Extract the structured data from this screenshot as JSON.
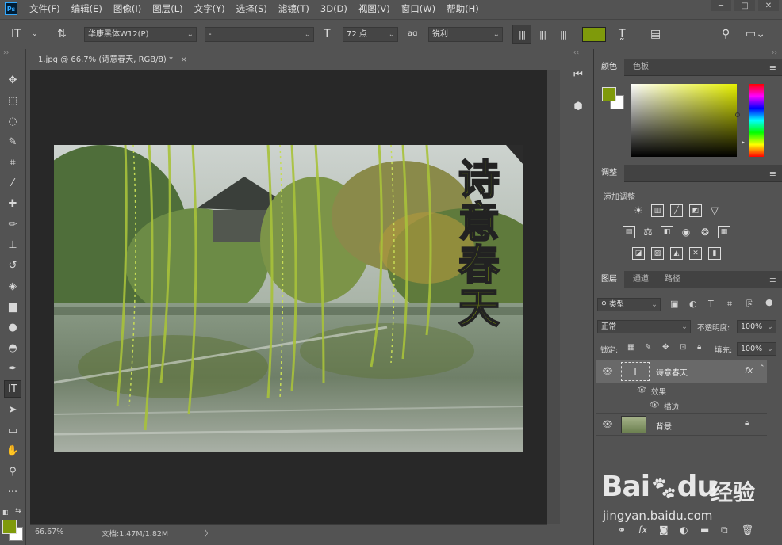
{
  "menu": {
    "logo": "Ps",
    "items": [
      "文件(F)",
      "编辑(E)",
      "图像(I)",
      "图层(L)",
      "文字(Y)",
      "选择(S)",
      "滤镜(T)",
      "3D(D)",
      "视图(V)",
      "窗口(W)",
      "帮助(H)"
    ],
    "window_controls": [
      "─",
      "□",
      "✕"
    ]
  },
  "options": {
    "font_family": "华康黑体W12(P)",
    "font_style": "-",
    "font_size": "72 点",
    "anti_alias": "锐利",
    "aa_label": "aɑ",
    "text_color": "#7f9a0b",
    "tool_glyph": "IT"
  },
  "document": {
    "tab_title": "1.jpg @ 66.7% (诗意春天, RGB/8) *",
    "close": "×"
  },
  "canvas_text": [
    "诗",
    "意",
    "春",
    "天"
  ],
  "status": {
    "zoom": "66.67%",
    "doc_size": "文档:1.47M/1.82M",
    "arrow": "〉"
  },
  "colors": {
    "foreground": "#7f9a0b",
    "background": "#ffffff",
    "panel_bg": "#535353",
    "canvas_bg": "#282828"
  },
  "color_panel": {
    "tabs": [
      "颜色",
      "色板"
    ]
  },
  "adjust_panel": {
    "tabs": [
      "调整"
    ],
    "add_label": "添加调整"
  },
  "layers_panel": {
    "tabs": [
      "图层",
      "通道",
      "路径"
    ],
    "filter_kind": "类型",
    "blend_mode": "正常",
    "opacity_label": "不透明度:",
    "opacity": "100%",
    "lock_label": "锁定:",
    "fill_label": "填充:",
    "fill": "100%",
    "layers": [
      {
        "name": "诗意春天",
        "fx": "fx",
        "effects_label": "效果",
        "stroke_label": "描边"
      },
      {
        "name": "背景"
      }
    ]
  },
  "watermark": {
    "brand": "Bai",
    "brand2": "du",
    "suffix": "经验",
    "url": "jingyan.baidu.com"
  }
}
